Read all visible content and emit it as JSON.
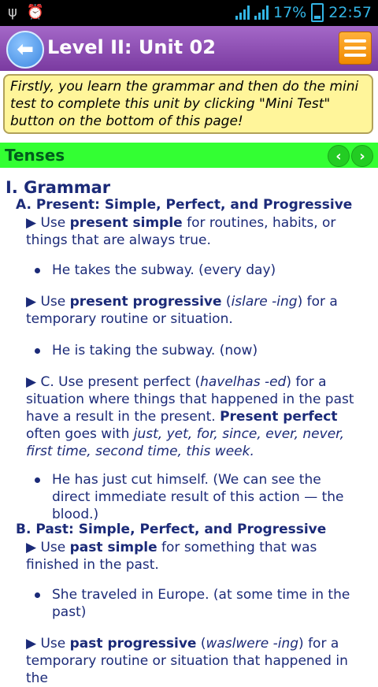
{
  "status": {
    "battery": "17%",
    "time": "22:57"
  },
  "header": {
    "title": "Level II: Unit 02"
  },
  "instruction": "Firstly, you learn the grammar and then do the mini test to complete this unit by clicking \"Mini Test\" button on the bottom of this page!",
  "section": {
    "label": "Tenses"
  },
  "grammar": {
    "heading": "I. Grammar",
    "a_heading": "A. Present: Simple, Perfect, and Progressive",
    "p1": {
      "prefix": "▶ Use ",
      "bold": "present simple",
      "rest": " for routines, habits, or things that are always true."
    },
    "e1": "He takes the subway. (every day)",
    "p2": {
      "prefix": "▶ Use ",
      "bold": "present progressive",
      "open": " (",
      "italic": "islare -ing",
      "close": ") for a temporary routine or situation."
    },
    "e2": "He is taking the subway. (now)",
    "p3": {
      "prefix": "▶ C. Use present perfect (",
      "italic": "havelhas -ed",
      "mid": ") for a situation where things that happened in the past have a result in the present. ",
      "bold": "Present perfect",
      "after": " often goes with ",
      "italic2": "just, yet, for, since, ever, never, first time, second time, this week."
    },
    "e3": "He has just cut himself. (We can see the direct immediate result of this action — the blood.)",
    "b_heading": "B. Past: Simple, Perfect, and Progressive",
    "p4": {
      "prefix": "▶ Use ",
      "bold": "past simple",
      "rest": " for something that was finished in the past."
    },
    "e4": "She traveled in Europe. (at some time in the past)",
    "p5": {
      "prefix": "▶ Use ",
      "bold": "past progressive",
      "open": " (",
      "italic": "waslwere -ing",
      "close": ") for a temporary routine or situation that happened in the"
    }
  }
}
